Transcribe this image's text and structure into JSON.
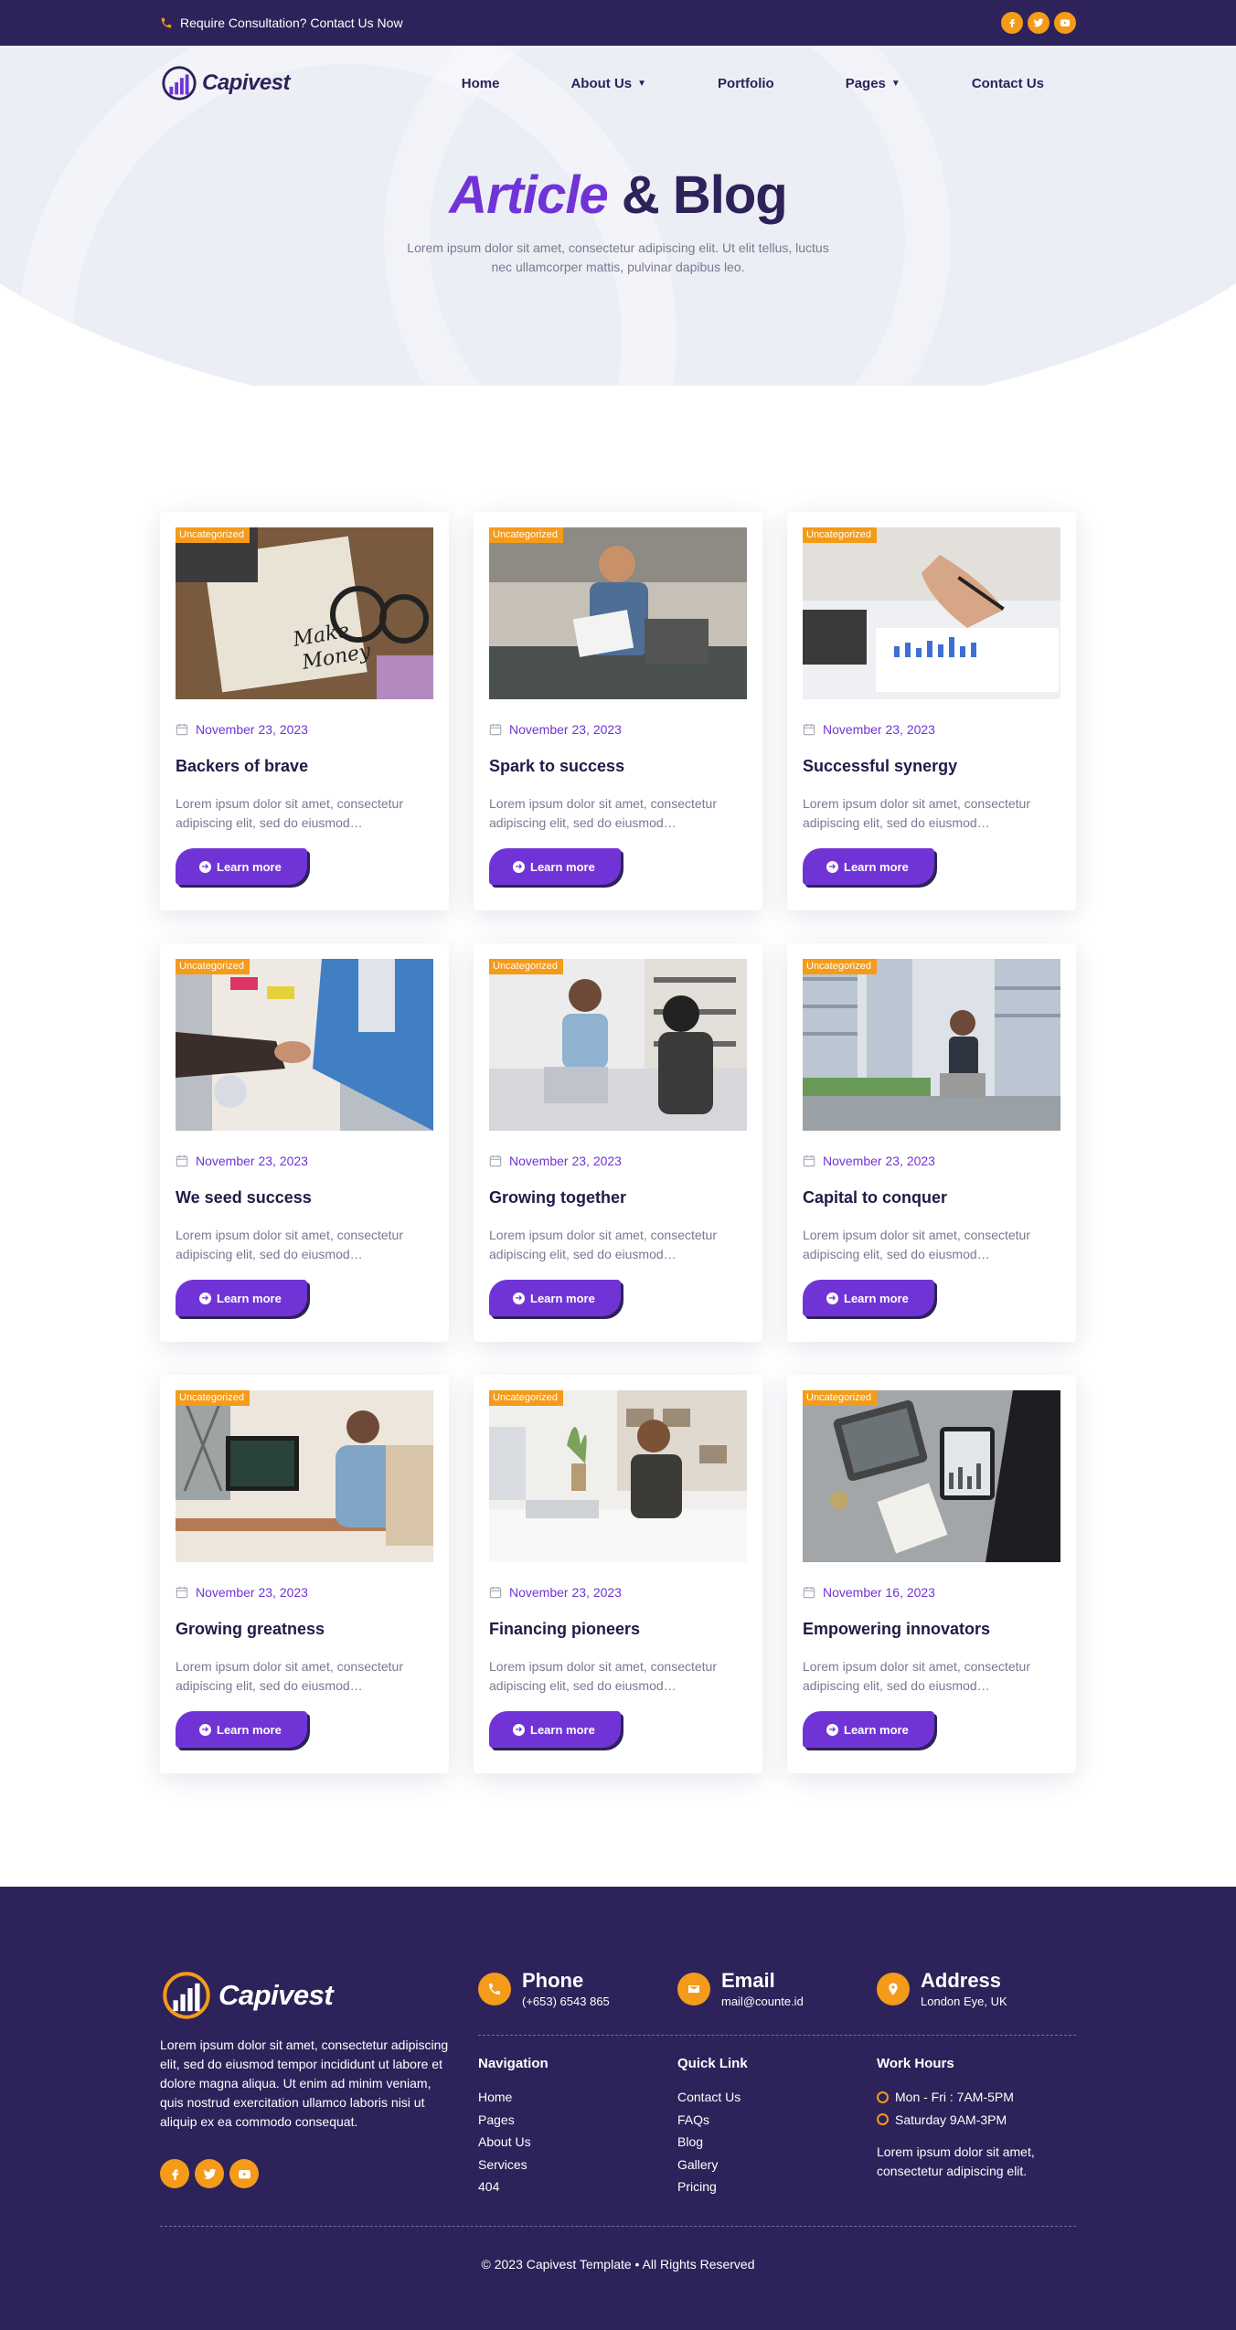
{
  "topbar": {
    "consultation": "Require Consultation? Contact Us Now",
    "socials": [
      "facebook-icon",
      "twitter-icon",
      "youtube-icon"
    ]
  },
  "brand": {
    "name": "Capivest"
  },
  "nav": {
    "home": "Home",
    "about": "About Us",
    "portfolio": "Portfolio",
    "pages": "Pages",
    "contact": "Contact Us"
  },
  "hero": {
    "title_accent": "Article",
    "title_rest": " & Blog",
    "subtitle": "Lorem ipsum dolor sit amet, consectetur adipiscing elit. Ut elit tellus, luctus nec ullamcorper mattis, pulvinar dapibus leo."
  },
  "posts": [
    {
      "tag": "Uncategorized",
      "date": "November 23, 2023",
      "title": "Backers of brave",
      "excerpt": "Lorem ipsum dolor sit amet, consectetur adipiscing elit, sed do eiusmod…",
      "button": "Learn more",
      "image": "desk-notes-glasses-image"
    },
    {
      "tag": "Uncategorized",
      "date": "November 23, 2023",
      "title": "Spark to success",
      "excerpt": "Lorem ipsum dolor sit amet, consectetur adipiscing elit, sed do eiusmod…",
      "button": "Learn more",
      "image": "man-reading-document-image"
    },
    {
      "tag": "Uncategorized",
      "date": "November 23, 2023",
      "title": "Successful synergy",
      "excerpt": "Lorem ipsum dolor sit amet, consectetur adipiscing elit, sed do eiusmod…",
      "button": "Learn more",
      "image": "hand-writing-charts-image"
    },
    {
      "tag": "Uncategorized",
      "date": "November 23, 2023",
      "title": "We seed success",
      "excerpt": "Lorem ipsum dolor sit amet, consectetur adipiscing elit, sed do eiusmod…",
      "button": "Learn more",
      "image": "handshake-image"
    },
    {
      "tag": "Uncategorized",
      "date": "November 23, 2023",
      "title": "Growing together",
      "excerpt": "Lorem ipsum dolor sit amet, consectetur adipiscing elit, sed do eiusmod…",
      "button": "Learn more",
      "image": "office-handshake-women-image"
    },
    {
      "tag": "Uncategorized",
      "date": "November 23, 2023",
      "title": "Capital to conquer",
      "excerpt": "Lorem ipsum dolor sit amet, consectetur adipiscing elit, sed do eiusmod…",
      "button": "Learn more",
      "image": "man-laptop-outdoor-image"
    },
    {
      "tag": "Uncategorized",
      "date": "November 23, 2023",
      "title": "Growing greatness",
      "excerpt": "Lorem ipsum dolor sit amet, consectetur adipiscing elit, sed do eiusmod…",
      "button": "Learn more",
      "image": "man-at-computer-image"
    },
    {
      "tag": "Uncategorized",
      "date": "November 23, 2023",
      "title": "Financing pioneers",
      "excerpt": "Lorem ipsum dolor sit amet, consectetur adipiscing elit, sed do eiusmod…",
      "button": "Learn more",
      "image": "woman-office-desk-image"
    },
    {
      "tag": "Uncategorized",
      "date": "November 16, 2023",
      "title": "Empowering innovators",
      "excerpt": "Lorem ipsum dolor sit amet, consectetur adipiscing elit, sed do eiusmod…",
      "button": "Learn more",
      "image": "tablet-charts-image"
    }
  ],
  "footer": {
    "description": "Lorem ipsum dolor sit amet, consectetur adipiscing elit, sed do eiusmod tempor incididunt ut labore et dolore magna aliqua. Ut enim ad minim veniam, quis nostrud exercitation ullamco laboris nisi ut aliquip ex ea commodo consequat.",
    "phone_title": "Phone",
    "phone_value": "(+653) 6543 865",
    "email_title": "Email",
    "email_value": "mail@counte.id",
    "address_title": "Address",
    "address_value": "London Eye, UK",
    "navigation_title": "Navigation",
    "navigation": [
      "Home",
      "Pages",
      "About Us",
      "Services",
      "404"
    ],
    "quicklink_title": "Quick Link",
    "quicklinks": [
      "Contact Us",
      "FAQs",
      "Blog",
      "Gallery",
      "Pricing"
    ],
    "workhours_title": "Work Hours",
    "hours_1": "Mon - Fri : 7AM-5PM",
    "hours_2": "Saturday 9AM-3PM",
    "hours_desc": "Lorem ipsum dolor sit amet, consectetur adipiscing elit.",
    "copyright": "© 2023 Capivest Template • All Rights Reserved"
  },
  "colors": {
    "primary": "#7034d6",
    "dark": "#2d2259",
    "accent": "#f59b1a"
  }
}
